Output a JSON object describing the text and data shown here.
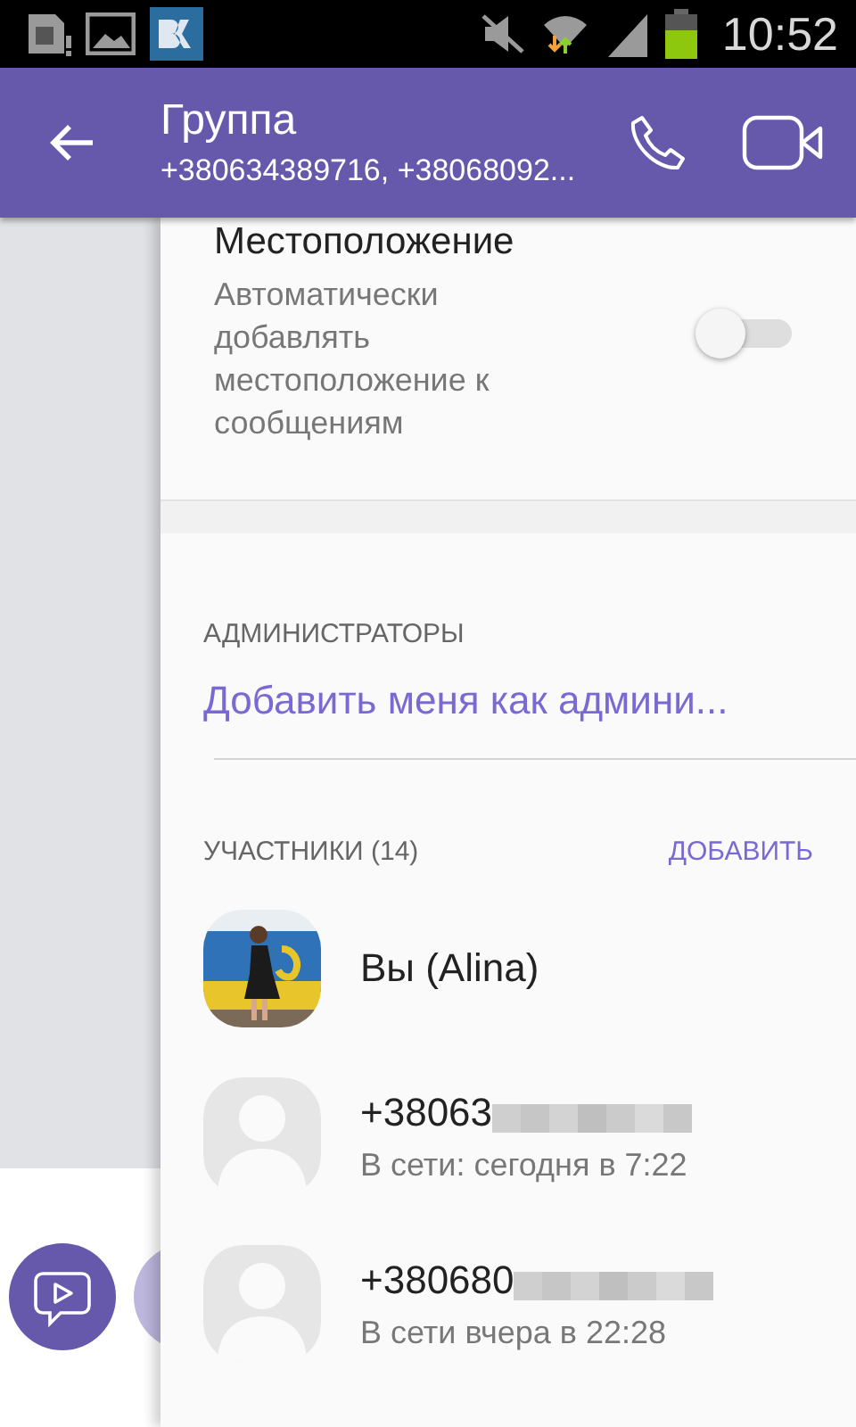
{
  "status_bar": {
    "time": "10:52"
  },
  "app_bar": {
    "title": "Группа",
    "subtitle": "+380634389716, +38068092..."
  },
  "location": {
    "title": "Местоположение",
    "description": "Автоматически добавлять местоположение к сообщениям",
    "on": false
  },
  "admins": {
    "header": "АДМИНИСТРАТОРЫ",
    "link": "Добавить меня как админи..."
  },
  "members": {
    "header": "УЧАСТНИКИ (14)",
    "action": "ДОБАВИТЬ",
    "items": [
      {
        "name": "Вы (Alina)"
      },
      {
        "kind": "placeholder",
        "name": "+38063",
        "status": "В сети: сегодня в 7:22",
        "redacted": true
      },
      {
        "kind": "placeholder",
        "name": "+380680",
        "status": "В сети вчера в 22:28",
        "redacted": true
      }
    ]
  }
}
